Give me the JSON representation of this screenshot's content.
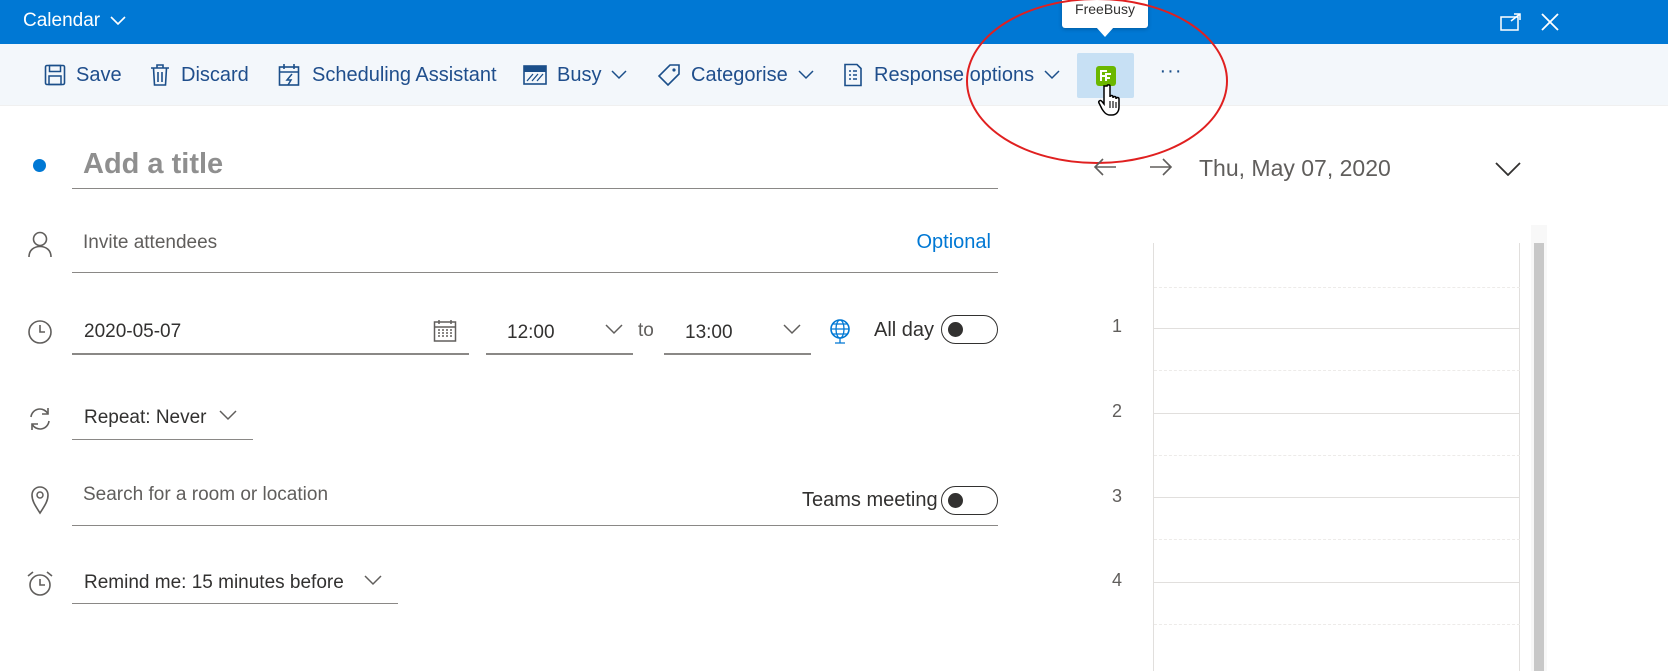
{
  "titlebar": {
    "title": "Calendar",
    "title_icon": "chevron-down-icon",
    "popout_icon": "popout-icon",
    "close_icon": "close-icon"
  },
  "tooltip": {
    "text": "FreeBusy"
  },
  "toolbar": {
    "save": "Save",
    "discard": "Discard",
    "scheduling": "Scheduling Assistant",
    "busy": "Busy",
    "categorise": "Categorise",
    "response": "Response options",
    "freebusy_icon": "freebusy-addin-icon",
    "more": "···"
  },
  "form": {
    "title_placeholder": "Add a title",
    "attendees_placeholder": "Invite attendees",
    "optional": "Optional",
    "date": "2020-05-07",
    "start_time": "12:00",
    "to": "to",
    "end_time": "13:00",
    "all_day": "All day",
    "all_day_on": false,
    "repeat": "Repeat:  Never",
    "location_placeholder": "Search for a room or location",
    "teams": "Teams meeting",
    "teams_on": false,
    "remind": "Remind me:  15 minutes before"
  },
  "day_pane": {
    "date": "Thu, May 07, 2020",
    "hours": [
      "1",
      "2",
      "3",
      "4"
    ]
  },
  "colors": {
    "accent": "#0078d4",
    "toolbar_bg": "#f3f7fb",
    "freebusy_green": "#6bb700",
    "annotation_red": "#e02020"
  }
}
